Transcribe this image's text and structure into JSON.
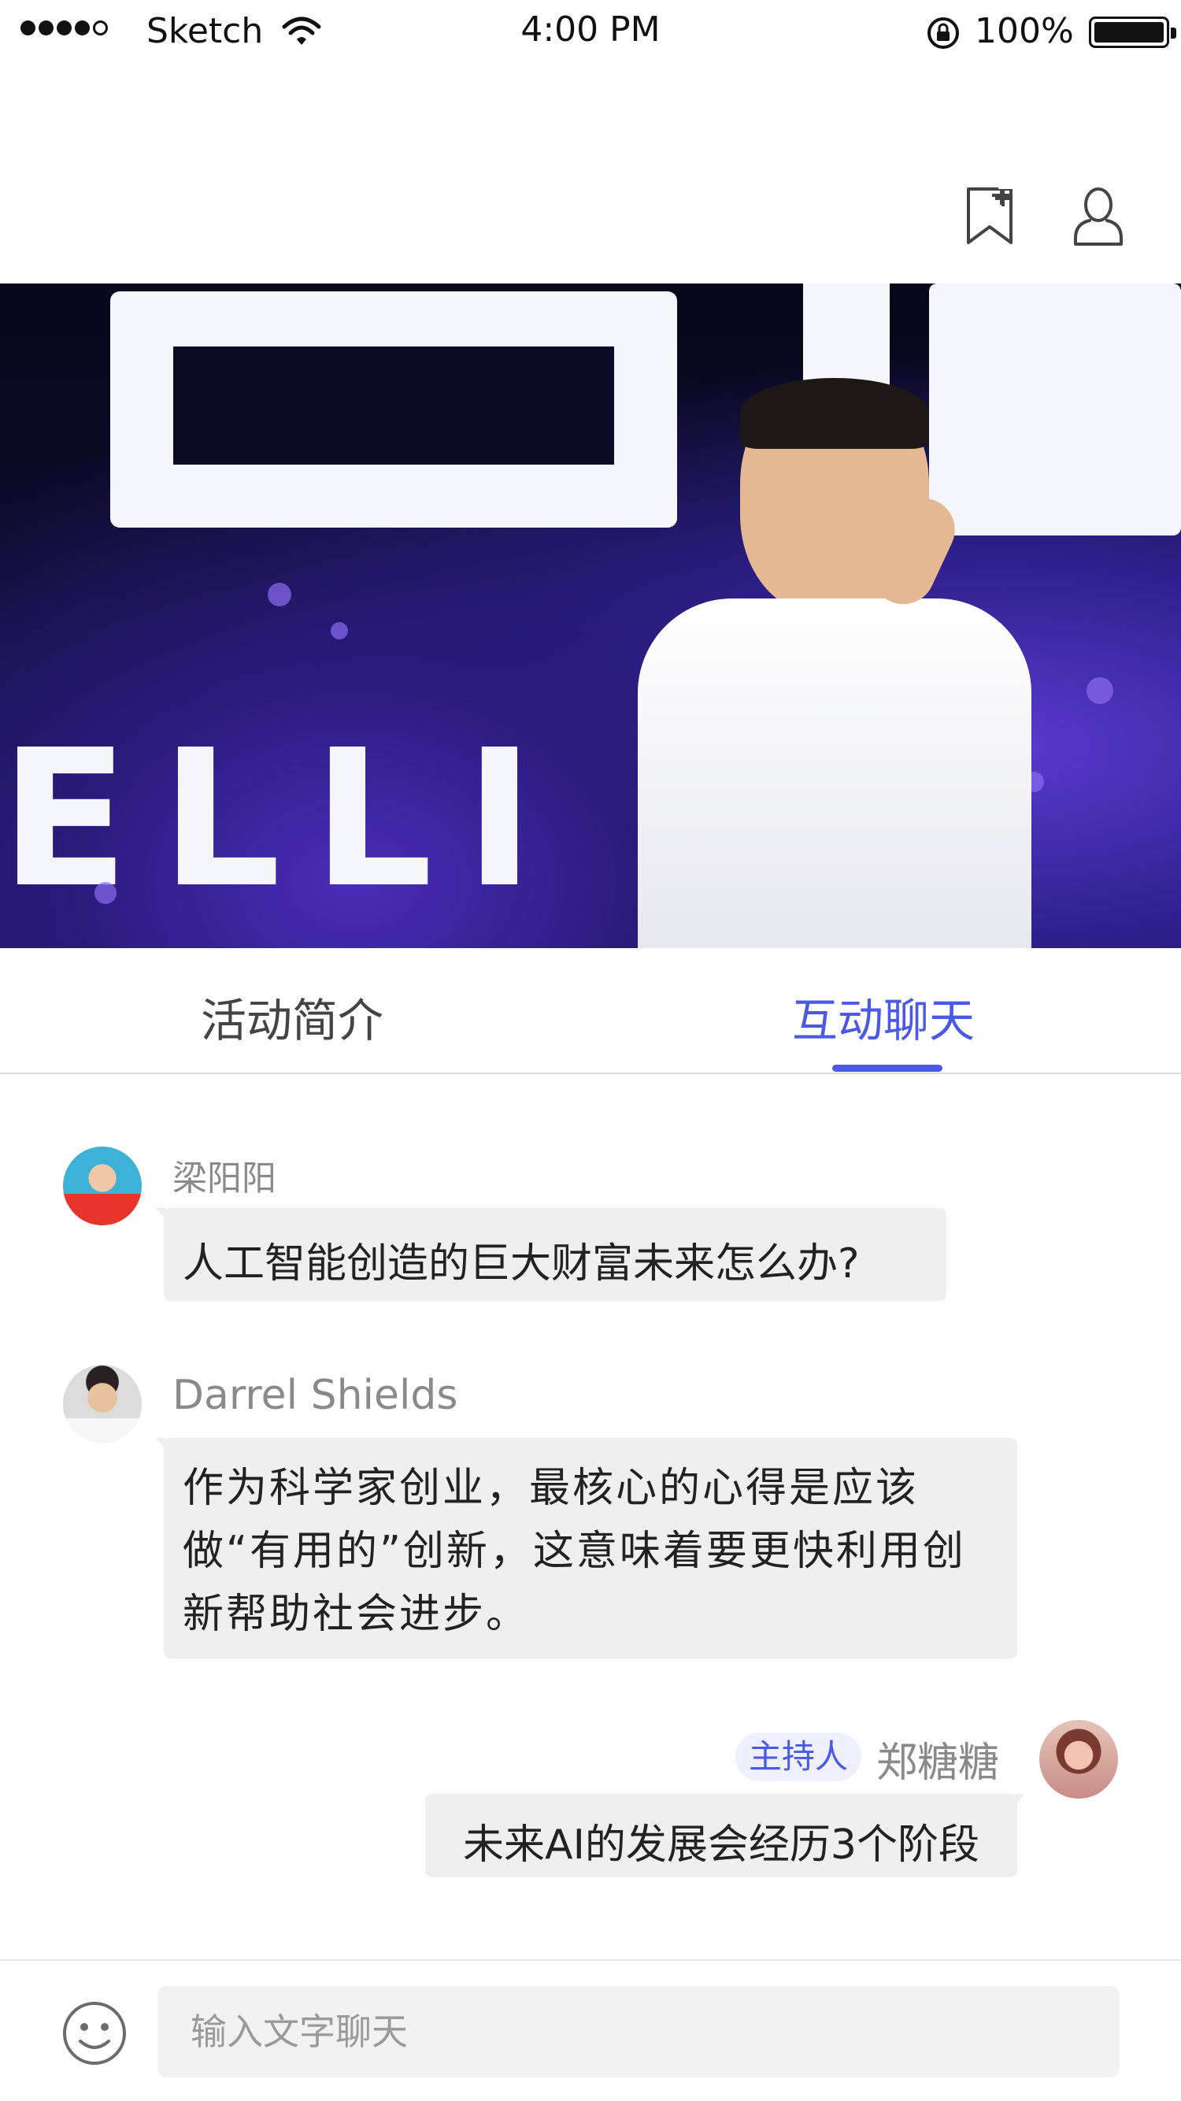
{
  "status_bar": {
    "carrier": "Sketch",
    "time": "4:00 PM",
    "battery": "100%"
  },
  "nav": {
    "icons": [
      "bookmark-add-icon",
      "user-icon"
    ]
  },
  "hero": {
    "background_letters": "ELLI"
  },
  "tabs": [
    {
      "label": "活动简介",
      "active": false
    },
    {
      "label": "互动聊天",
      "active": true
    }
  ],
  "chat": {
    "messages": [
      {
        "sender": "梁阳阳",
        "text": "人工智能创造的巨大财富未来怎么办?",
        "side": "left"
      },
      {
        "sender": "Darrel Shields",
        "text": "作为科学家创业，最核心的心得是应该做“有用的”创新，这意味着要更快利用创新帮助社会进步。",
        "side": "left"
      },
      {
        "sender": "郑糖糖",
        "badge": "主持人",
        "text": "未来AI的发展会经历3个阶段",
        "side": "right"
      }
    ]
  },
  "input": {
    "placeholder": "输入文字聊天"
  },
  "colors": {
    "accent": "#4b5ae4",
    "bubble": "#efefef",
    "muted_text": "#8a8a8a"
  }
}
